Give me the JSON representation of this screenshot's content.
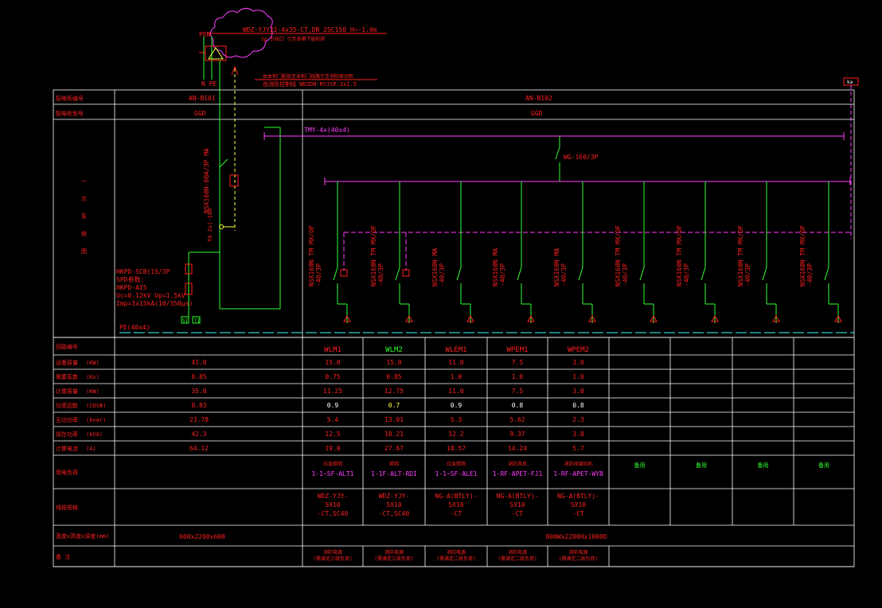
{
  "colors": {
    "bg": "#000000",
    "grid": "#ffffff",
    "red": "#ff2020",
    "green": "#30ff30",
    "magenta": "#ff40ff",
    "yellow": "#ffff40",
    "cyan": "#40ffff",
    "white": "#ffffff"
  },
  "incoming": {
    "cable": "WDZ-YJY22-4x35-CT,DB 2SC150  H=-1.0m",
    "note": "1ρ 引线口 引至本箱下层机柜",
    "pen": "PEN",
    "npe": "N PE",
    "right_note": "由本柜门配接至本柜门线路引至消防联动柜",
    "right_cable": "由消防控制线 WDZDN-RYJSP-2x1.5",
    "corner_tag": "ka"
  },
  "header_rows": {
    "cabinet_no_label": "配电柜编号",
    "cabinet_model_label": "配电柜型号",
    "cabinet_no_left": "AN-B101",
    "cabinet_no_right": "AN-B102",
    "cabinet_model_left": "GGD",
    "cabinet_model_right": "GGD"
  },
  "diagram": {
    "left_side_label": "一次系统图",
    "busbar": "TMY-4x(40x4)",
    "main_breaker": "WG-160/3P",
    "incoming_breaker": "NSX160N-80A/3P MA",
    "meter": "TA 2x(-100",
    "spd_lines": [
      "HKPD-SCB(15/3P",
      "SPD参数:",
      "HKPD-AI5",
      "Uc=0.12kV Up=1.5kV",
      "Imp=3x15kA(10/350μs)"
    ],
    "spd_tags": [
      "SI",
      "TI"
    ],
    "pe_label": "PE(40x4)",
    "branches": [
      {
        "name": "NSX160N TM MX/OF",
        "rating": "-40/3P"
      },
      {
        "name": "NSX160N TM MX/OF",
        "rating": "-40/3P"
      },
      {
        "name": "NSX160N MA",
        "rating": "-40/3P"
      },
      {
        "name": "NSX160N MA",
        "rating": "-40/3P"
      },
      {
        "name": "NSX160N MA",
        "rating": "-40/3P"
      },
      {
        "name": "NSX160N TM MX/OF",
        "rating": "-40/3P"
      },
      {
        "name": "NSX160N TM MX/OF",
        "rating": "-40/3P"
      },
      {
        "name": "NSX160N TM MX/OF",
        "rating": "-40/3P"
      },
      {
        "name": "NSX160N TM MX/OF",
        "rating": "-40/3P"
      }
    ]
  },
  "table": {
    "row_labels": [
      {
        "name": "回路编号",
        "unit": ""
      },
      {
        "name": "设备容量",
        "unit": "(KW)"
      },
      {
        "name": "需要系数",
        "unit": "(Kx)"
      },
      {
        "name": "计算容量",
        "unit": "(KW)"
      },
      {
        "name": "功率因数",
        "unit": "(COSΦ)"
      },
      {
        "name": "无功功率",
        "unit": "(kvar)"
      },
      {
        "name": "视在功率",
        "unit": "(kVA)"
      },
      {
        "name": "计算电流",
        "unit": "(A)"
      },
      {
        "name": "用电负荷",
        "unit": ""
      },
      {
        "name": "线缆规格",
        "unit": ""
      },
      {
        "name": "宽度x高度x深度(mm)",
        "unit": ""
      },
      {
        "name": "备  注",
        "unit": ""
      }
    ],
    "total": [
      "",
      "41.0",
      "0.85",
      "35.0",
      "0.83",
      "23.78",
      "42.3",
      "64.12"
    ],
    "circuits": [
      {
        "no": "WLM1",
        "p": "15.0",
        "kx": "0.75",
        "pc": "11.25",
        "cos": "0.9",
        "q": "5.4",
        "s": "12.5",
        "i": "19.0",
        "load_title": "应急照明",
        "load_id": "1-1~5F-ALT1",
        "cable": [
          "WDZ-YJY-",
          "5X10",
          "-CT,SC40"
        ],
        "remark": [
          "消防电源",
          "(需满足三级负荷)"
        ]
      },
      {
        "no": "WLM2",
        "p": "15.0",
        "kx": "0.85",
        "pc": "12.75",
        "cos": "0.7",
        "q": "13.01",
        "s": "18.21",
        "i": "27.67",
        "load_title": "照明",
        "load_id": "1-1F-ALT-RDI",
        "cable": [
          "WDZ-YJY-",
          "5X10",
          "-CT,SC40"
        ],
        "remark": [
          "消防电源",
          "(需满足三级负荷)"
        ]
      },
      {
        "no": "WLEM1",
        "p": "11.0",
        "kx": "1.0",
        "pc": "11.0",
        "cos": "0.9",
        "q": "5.3",
        "s": "12.2",
        "i": "18.57",
        "load_title": "应急照明",
        "load_id": "1-1~5F-ALE1",
        "cable": [
          "NG-A(BTLY)-",
          "5X10",
          "-CT"
        ],
        "remark": [
          "消防电源",
          "(需满足二级负荷)"
        ]
      },
      {
        "no": "WPEM1",
        "p": "7.5",
        "kx": "1.0",
        "pc": "7.5",
        "cos": "0.8",
        "q": "5.62",
        "s": "9.37",
        "i": "14.24",
        "load_title": "消防风机",
        "load_id": "1-RF-APET-FJ1",
        "cable": [
          "NG-A(BTLY)-",
          "5X10",
          "-CT"
        ],
        "remark": [
          "消防电源",
          "(需满足二级负荷)"
        ]
      },
      {
        "no": "WPEM2",
        "p": "3.0",
        "kx": "1.0",
        "pc": "3.0",
        "cos": "0.8",
        "q": "2.3",
        "s": "3.8",
        "i": "5.7",
        "load_title": "消防排烟风机",
        "load_id": "1-RF-APET-WYB",
        "cable": [
          "NG-A(BTLY)-",
          "5X10",
          "-CT"
        ],
        "remark": [
          "消防电源",
          "(需满足二级负荷)"
        ]
      }
    ],
    "spares": [
      "备用",
      "备用",
      "备用",
      "备用"
    ],
    "dims_left": "600x2200x600",
    "dims_right": "800Wx2200Hx1000D"
  }
}
